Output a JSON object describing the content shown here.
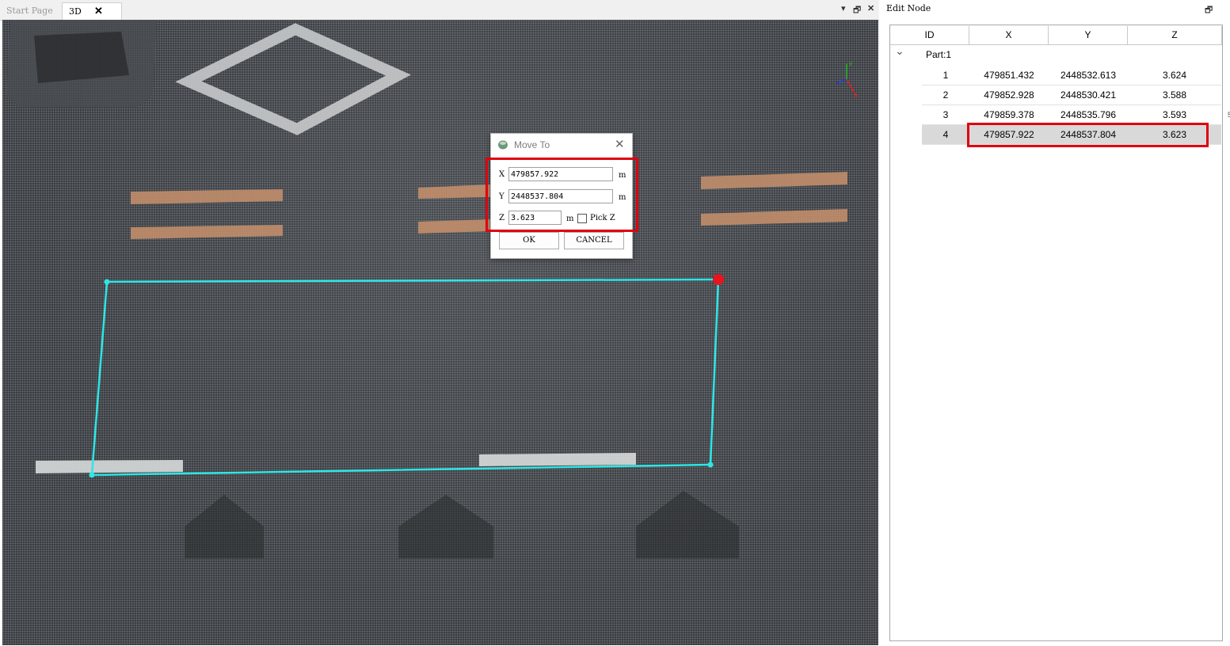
{
  "tabs": [
    {
      "label": "Start Page",
      "active": false
    },
    {
      "label": "3D",
      "active": true,
      "close": "✕"
    }
  ],
  "window_controls": {
    "dropdown": "▾",
    "restore": "🗗",
    "close": "✕"
  },
  "viewport": {
    "colors": {
      "polygon": "#2ee6e6",
      "selected_node": "#e8141e",
      "background": "#34373b"
    }
  },
  "dialog": {
    "title": "Move To",
    "close": "✕",
    "x_label": "X",
    "x_value": "479857.922",
    "y_label": "Y",
    "y_value": "2448537.804",
    "z_label": "Z",
    "z_value": "3.623",
    "unit": "m",
    "pick_z_label": "Pick Z",
    "pick_z_checked": false,
    "ok_label": "OK",
    "cancel_label": "CANCEL"
  },
  "panel": {
    "title": "Edit Node",
    "pin": "🗗",
    "columns": [
      "ID",
      "X",
      "Y",
      "Z"
    ],
    "group_label": "Part:1",
    "group_toggle": "⌄",
    "rows": [
      {
        "id": "1",
        "x": "479851.432",
        "y": "2448532.613",
        "z": "3.624"
      },
      {
        "id": "2",
        "x": "479852.928",
        "y": "2448530.421",
        "z": "3.588"
      },
      {
        "id": "3",
        "x": "479859.378",
        "y": "2448535.796",
        "z": "3.593"
      },
      {
        "id": "4",
        "x": "479857.922",
        "y": "2448537.804",
        "z": "3.623"
      }
    ],
    "selected_row": "4"
  },
  "edge_marks": {
    "top": "5",
    "middle": "⋮"
  }
}
